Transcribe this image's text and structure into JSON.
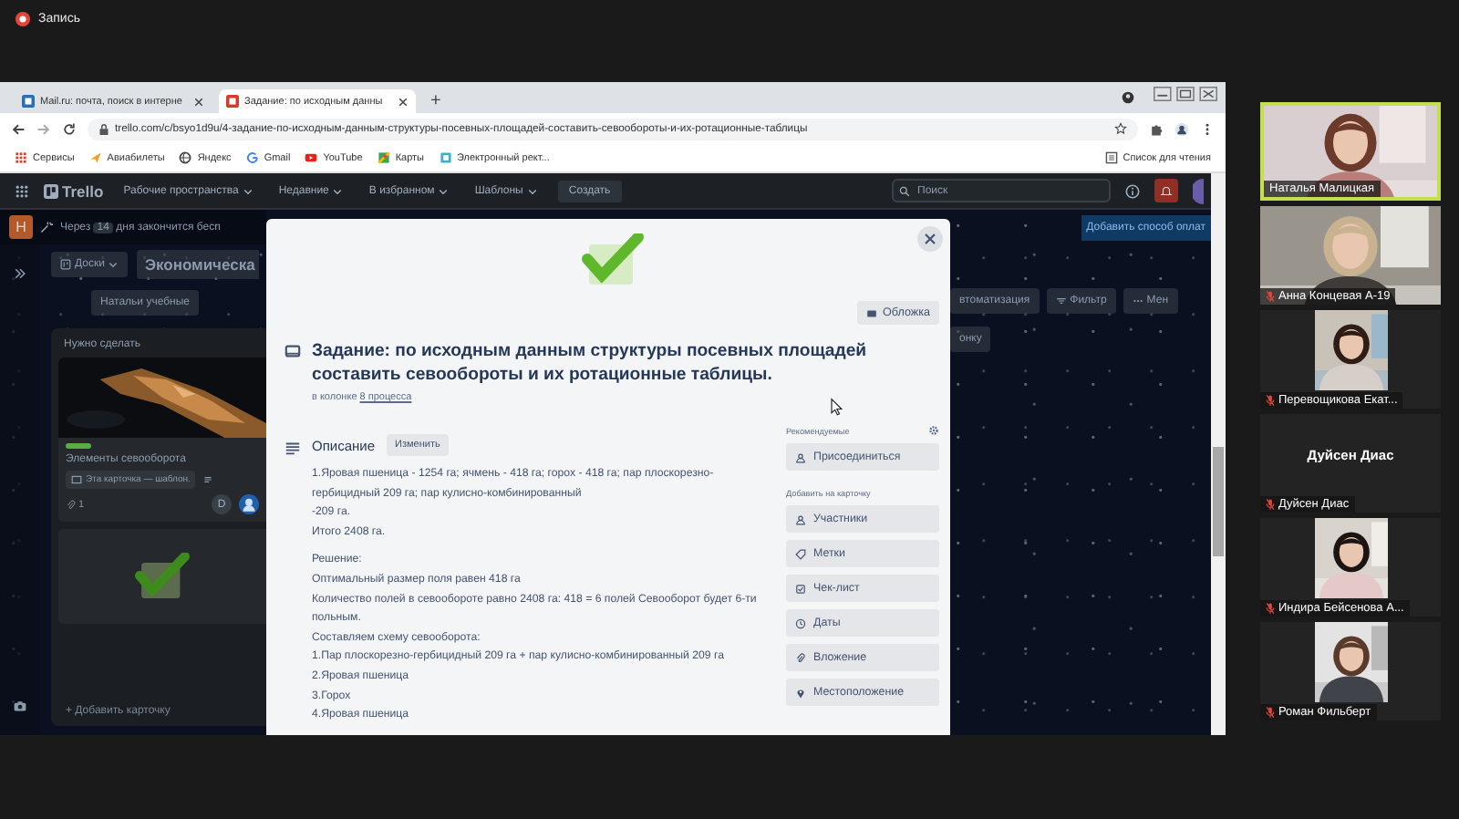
{
  "meeting": {
    "recording": "Запись"
  },
  "browser": {
    "tabs": [
      {
        "title": "Mail.ru: почта, поиск в интерне",
        "selected": false
      },
      {
        "title": "Задание: по исходным данны",
        "selected": true
      }
    ],
    "new_tab": "+",
    "url": "trello.com/c/bsyo1d9u/4-задание-по-исходным-данным-структуры-посевных-площадей-составить-севообороты-и-их-ротационные-таблицы",
    "bookmarks": [
      {
        "kind": "apps",
        "label": "Сервисы"
      },
      {
        "kind": "plane",
        "label": "Авиабилеты"
      },
      {
        "kind": "globe",
        "label": "Яндекс"
      },
      {
        "kind": "gmail",
        "label": "Gmail"
      },
      {
        "kind": "youtube",
        "label": "YouTube"
      },
      {
        "kind": "maps",
        "label": "Карты"
      },
      {
        "kind": "page",
        "label": "Электронный рект..."
      }
    ],
    "reading_list": "Список для чтения"
  },
  "trello": {
    "logo": "Trello",
    "nav": [
      "Рабочие пространства",
      "Недавние",
      "В избранном",
      "Шаблоны"
    ],
    "create": "Создать",
    "search_placeholder": "Поиск",
    "trial": {
      "avatar": "H",
      "before": "Через",
      "days": "14",
      "after": "дня закончится бесп"
    },
    "add_payment": "Добавить способ оплат",
    "boards": "Доски",
    "board_name": "Экономическа",
    "workspace": "Натальи учебные",
    "automation": "втоматизация",
    "filter": "Фильтр",
    "menu": "Мен",
    "add_list": "онку",
    "list": {
      "title": "Нужно сделать",
      "cards": [
        {
          "color": "#5aac44",
          "title": "Элементы севооборота",
          "template_badge": "Эта карточка — шаблон.",
          "attachments": "1",
          "members": [
            "D"
          ]
        },
        {
          "kind": "check"
        }
      ],
      "add_card": "+ Добавить карточку"
    }
  },
  "card": {
    "cover_button": "Обложка",
    "title": "Задание: по исходным данным структуры посевных площадей составить севообороты и их ротационные таблицы.",
    "list_prefix": "в колонке",
    "list_name": "8 процесса",
    "description_heading": "Описание",
    "edit_button": "Изменить",
    "description": [
      [
        "1.Яровая пшеница - 1254 га; ячмень - 418 га; горох - 418 га; пар плоскорезно-гербицидный 209 га; пар кулисно-комбинированный",
        "-209 га.",
        "Итого 2408 га."
      ],
      [
        "Решение:",
        "Оптимальный размер поля равен 418 га",
        "Количество полей в севообороте равно 2408 га: 418 = 6 полей Севооборот будет 6-ти польным.",
        "Составляем схему севооборота:",
        "1.Пар плоскорезно-гербицидный 209 га + пар кулисно-комбинированный 209 га",
        "2.Яровая пшеница",
        "3.Горох",
        "4.Яровая пшеница"
      ]
    ],
    "suggested_heading": "Рекомендуемые",
    "join": "Присоединиться",
    "add_heading": "Добавить на карточку",
    "actions": [
      {
        "kind": "members",
        "label": "Участники"
      },
      {
        "kind": "labels",
        "label": "Метки"
      },
      {
        "kind": "checklist",
        "label": "Чек-лист"
      },
      {
        "kind": "dates",
        "label": "Даты"
      },
      {
        "kind": "attachment",
        "label": "Вложение"
      },
      {
        "kind": "location",
        "label": "Местоположение"
      }
    ]
  },
  "participants": [
    {
      "kind": "video_wide",
      "name": "Наталья Малицкая",
      "speaking": true,
      "muted": false
    },
    {
      "kind": "video_wide",
      "name": "Анна Концевая А-19",
      "speaking": false,
      "muted": true
    },
    {
      "kind": "video",
      "name": "Перевощикова Екат...",
      "speaking": false,
      "muted": true
    },
    {
      "kind": "name_only",
      "display_name": "Дуйсен Диас",
      "name": "Дуйсен Диас",
      "speaking": false,
      "muted": true
    },
    {
      "kind": "video",
      "name": "Индира Бейсенова А...",
      "speaking": false,
      "muted": true
    },
    {
      "kind": "video",
      "name": "Роман Фильберт",
      "speaking": false,
      "muted": true
    }
  ]
}
